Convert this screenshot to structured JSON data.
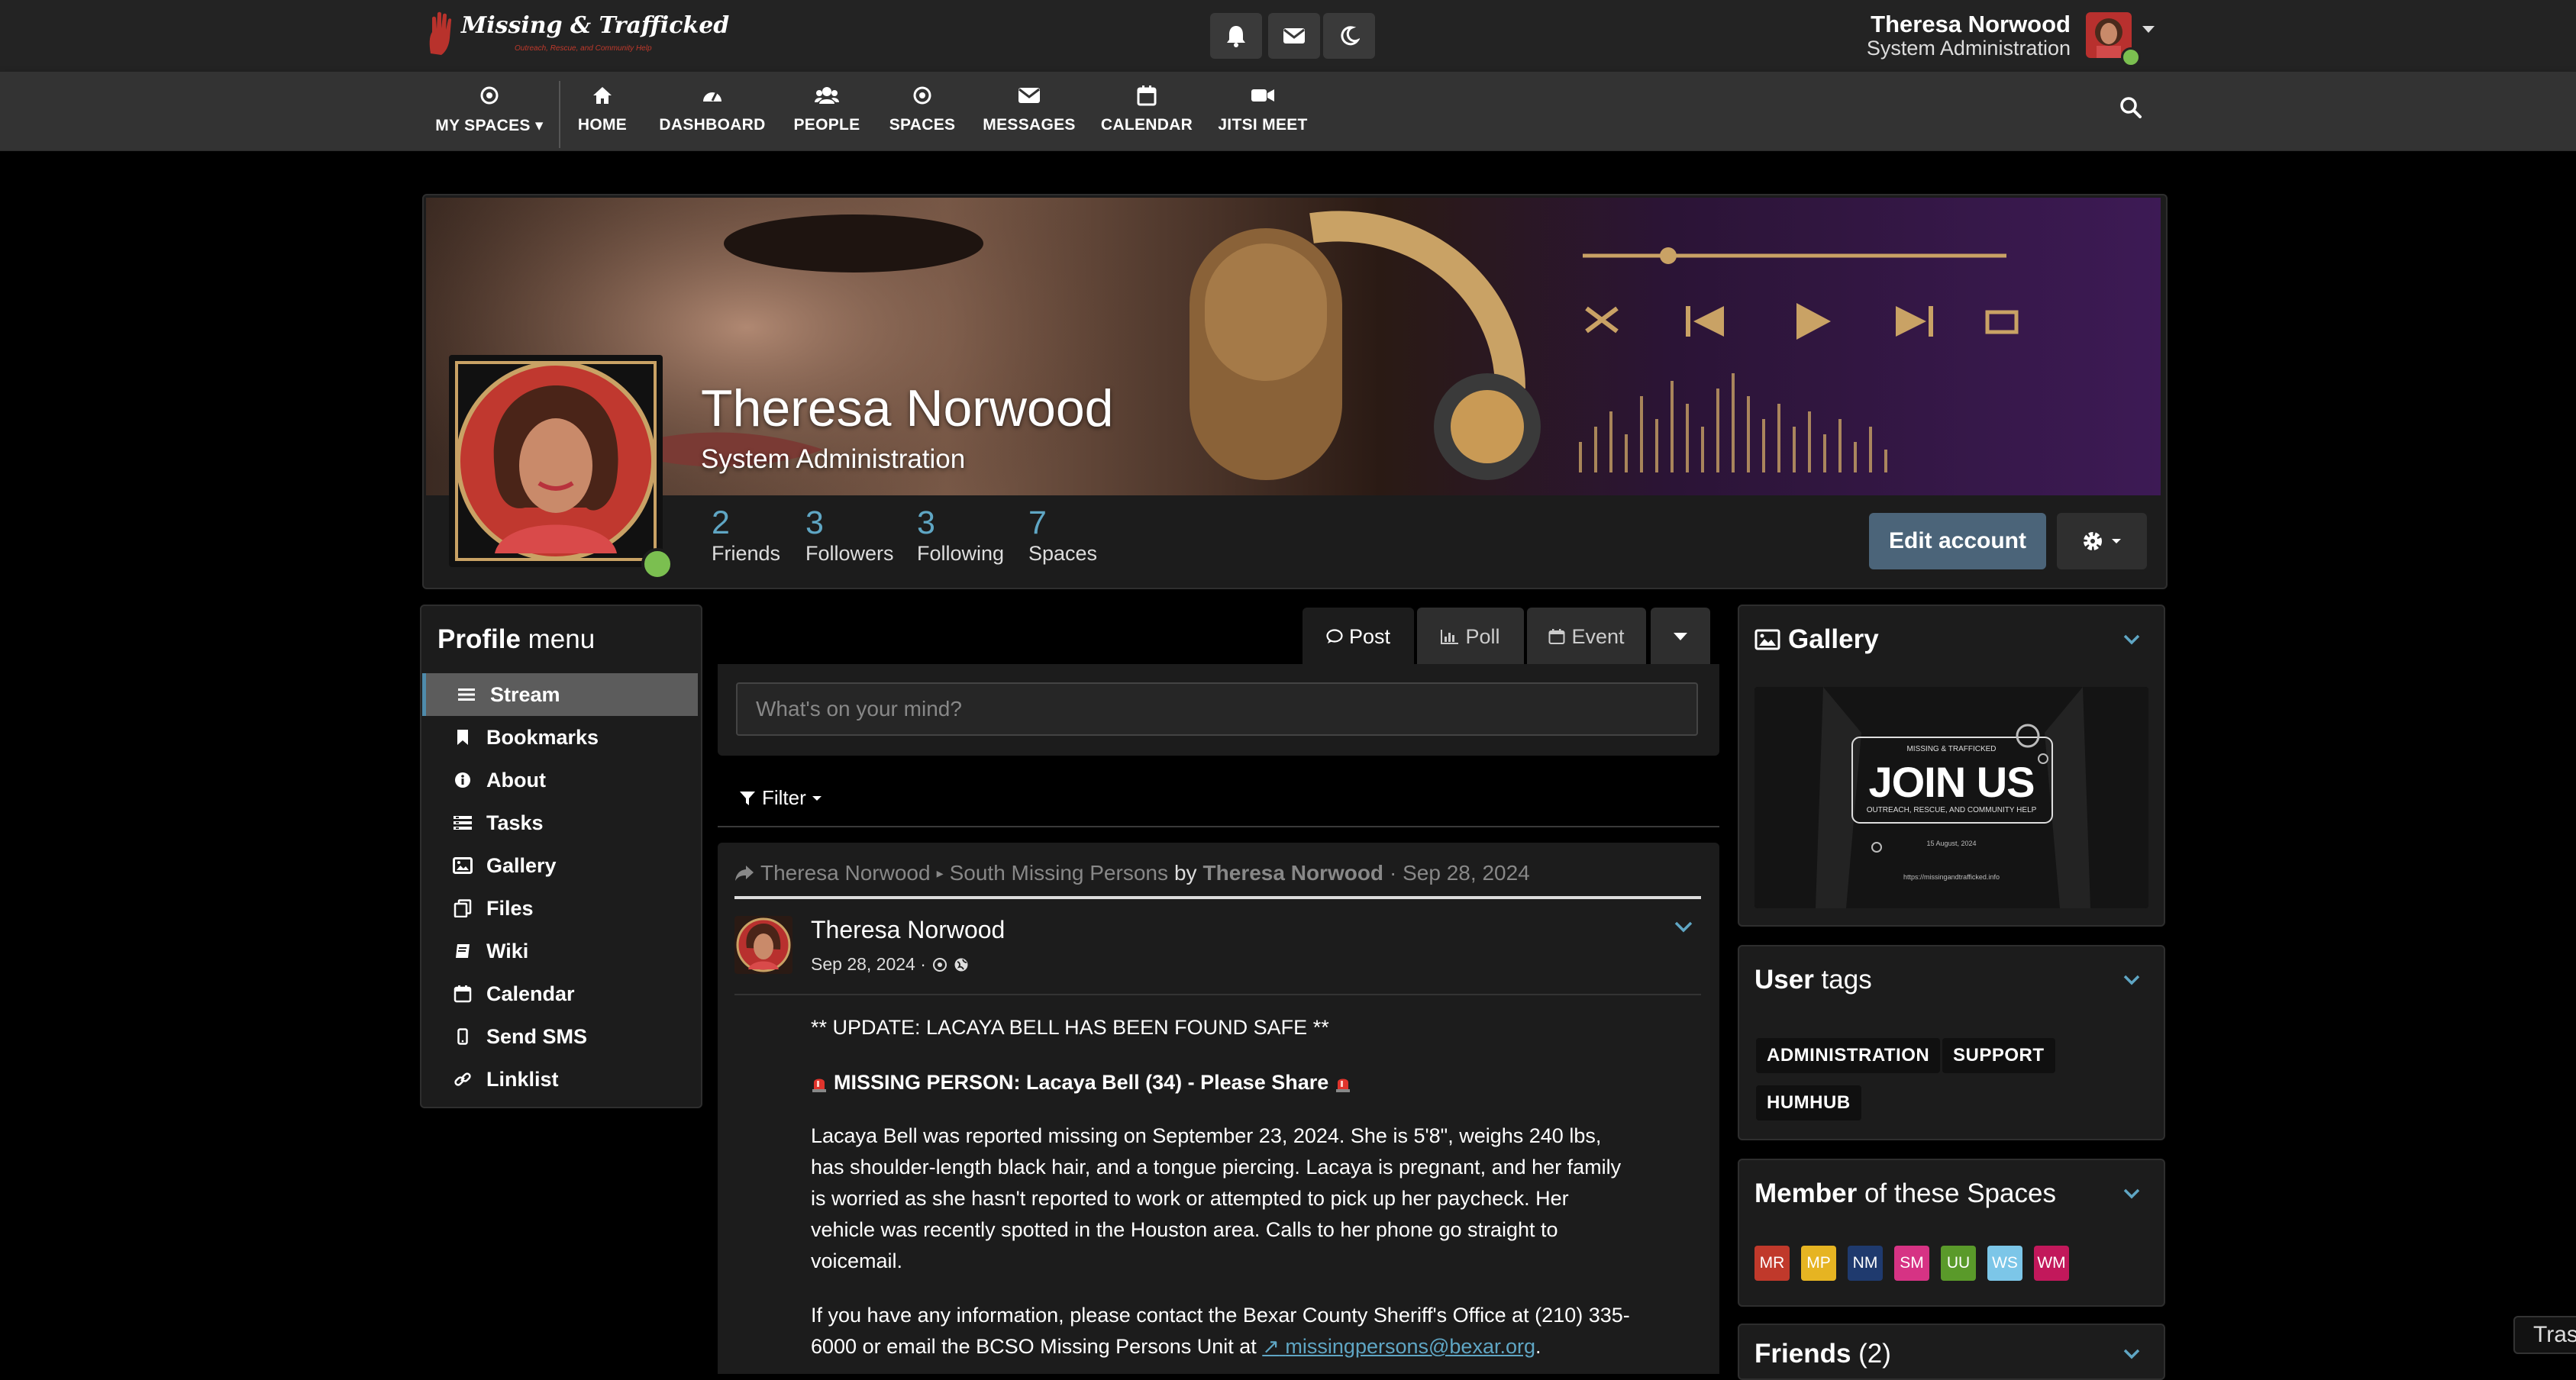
{
  "brand": {
    "logo_text": "Missing & Trafficked",
    "logo_tagline": "Outreach, Rescue, and Community Help"
  },
  "topbar": {
    "icons": [
      "bell-icon",
      "envelope-icon",
      "moon-icon"
    ],
    "user_name": "Theresa Norwood",
    "user_role": "System Administration"
  },
  "nav": {
    "items": [
      {
        "label": "MY SPACES",
        "icon": "dot-circle-icon"
      },
      {
        "label": "HOME",
        "icon": "home-icon"
      },
      {
        "label": "DASHBOARD",
        "icon": "tachometer-icon"
      },
      {
        "label": "PEOPLE",
        "icon": "users-icon"
      },
      {
        "label": "SPACES",
        "icon": "dot-circle-icon"
      },
      {
        "label": "MESSAGES",
        "icon": "envelope-icon"
      },
      {
        "label": "CALENDAR",
        "icon": "calendar-icon"
      },
      {
        "label": "JITSI MEET",
        "icon": "video-icon"
      }
    ]
  },
  "profile": {
    "name": "Theresa Norwood",
    "role": "System Administration",
    "stats": [
      {
        "value": "2",
        "label": "Friends"
      },
      {
        "value": "3",
        "label": "Followers"
      },
      {
        "value": "3",
        "label": "Following"
      },
      {
        "value": "7",
        "label": "Spaces"
      }
    ],
    "edit_label": "Edit account"
  },
  "profile_menu": {
    "title_strong": "Profile",
    "title_rest": " menu",
    "items": [
      {
        "label": "Stream",
        "icon": "bars-icon",
        "active": true
      },
      {
        "label": "Bookmarks",
        "icon": "bookmark-icon"
      },
      {
        "label": "About",
        "icon": "info-circle-icon"
      },
      {
        "label": "Tasks",
        "icon": "tasks-icon"
      },
      {
        "label": "Gallery",
        "icon": "image-icon"
      },
      {
        "label": "Files",
        "icon": "files-icon"
      },
      {
        "label": "Wiki",
        "icon": "book-icon"
      },
      {
        "label": "Calendar",
        "icon": "calendar-icon"
      },
      {
        "label": "Send SMS",
        "icon": "mobile-icon"
      },
      {
        "label": "Linklist",
        "icon": "link-icon"
      }
    ]
  },
  "composer": {
    "tabs": [
      "Post",
      "Poll",
      "Event"
    ],
    "placeholder": "What's on your mind?",
    "filter_label": "Filter"
  },
  "post": {
    "context_author": "Theresa Norwood",
    "context_space": "South Missing Persons",
    "context_by": "by",
    "context_by_author": "Theresa Norwood",
    "context_date": "· Sep 28, 2024",
    "author": "Theresa Norwood",
    "date": "Sep 28, 2024 ·",
    "line1": "** UPDATE: LACAYA BELL HAS BEEN FOUND SAFE **",
    "line2": "MISSING PERSON: Lacaya Bell (34) - Please Share",
    "para1": "Lacaya Bell was reported missing on September 23, 2024. She is 5'8\", weighs 240 lbs, has shoulder-length black hair, and a tongue piercing. Lacaya is pregnant, and her family is worried as she hasn't reported to work or attempted to pick up her paycheck. Her vehicle was recently spotted in the Houston area. Calls to her phone go straight to voicemail.",
    "para2_prefix": "If you have any information, please contact the Bexar County Sheriff's Office at (210) 335-6000 or email the BCSO Missing Persons Unit at",
    "para2_email": "missingpersons@bexar.org",
    "para2_suffix": "."
  },
  "right": {
    "gallery_title": "Gallery",
    "gallery_image_text": {
      "top": "MISSING & TRAFFICKED",
      "main": "JOIN US",
      "sub": "OUTREACH, RESCUE, AND COMMUNITY HELP",
      "date": "15 August, 2024",
      "url": "https://missingandtrafficked.info"
    },
    "user_tags_strong": "User",
    "user_tags_rest": " tags",
    "tags": [
      "ADMINISTRATION",
      "SUPPORT",
      "HUMHUB"
    ],
    "member_strong": "Member",
    "member_rest": " of these Spaces",
    "spaces": [
      {
        "abbr": "MR",
        "color": "#c0392b"
      },
      {
        "abbr": "MP",
        "color": "#e6b422"
      },
      {
        "abbr": "NM",
        "color": "#1f3a6e"
      },
      {
        "abbr": "SM",
        "color": "#d63384"
      },
      {
        "abbr": "UU",
        "color": "#5a9a2a"
      },
      {
        "abbr": "WS",
        "color": "#7cc6e8"
      },
      {
        "abbr": "WM",
        "color": "#c2185b"
      }
    ],
    "friends_strong": "Friends",
    "friends_rest": " (2)"
  },
  "trash_label": "Trash"
}
